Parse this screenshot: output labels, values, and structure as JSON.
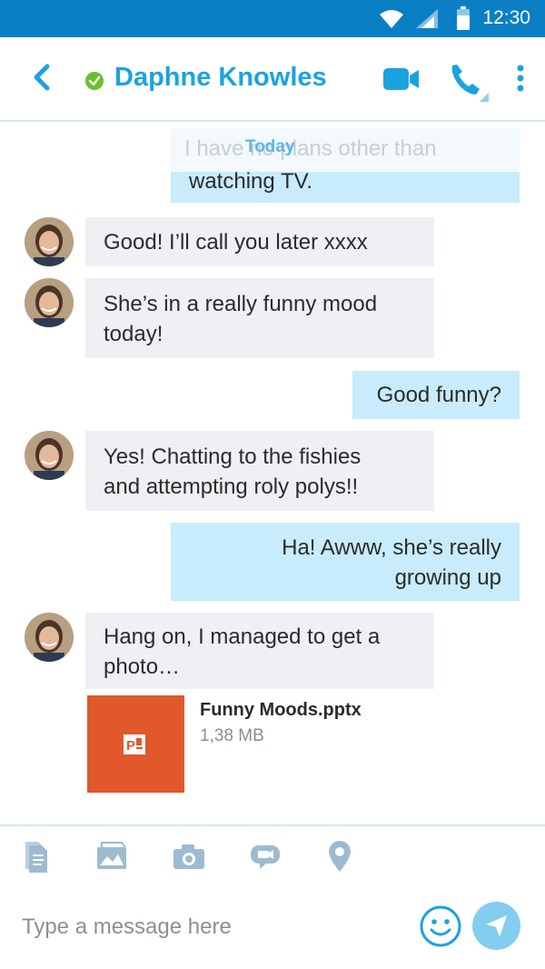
{
  "status_bar": {
    "time": "12:30"
  },
  "header": {
    "contact_name": "Daphne Knowles",
    "presence": "online",
    "accent_color": "#1aa3e1",
    "presence_color": "#6cbf2b",
    "icons": [
      "back-arrow-icon",
      "video-camera-icon",
      "phone-icon",
      "more-vertical-icon"
    ]
  },
  "chat": {
    "day_label": "Today",
    "faded_preview": "I have no plans other than",
    "messages": [
      {
        "direction": "out",
        "lines": [
          "watching TV."
        ]
      },
      {
        "direction": "in",
        "lines": [
          "Good! I’ll call you later xxxx"
        ]
      },
      {
        "direction": "in",
        "lines": [
          "She’s in a really funny mood",
          "today!"
        ]
      },
      {
        "direction": "out",
        "lines": [
          "Good funny?"
        ]
      },
      {
        "direction": "in",
        "lines": [
          "Yes! Chatting to the fishies",
          "and attempting roly polys!!"
        ]
      },
      {
        "direction": "out",
        "lines": [
          "Ha! Awww, she’s really",
          "growing up"
        ]
      },
      {
        "direction": "in",
        "lines": [
          "Hang on, I managed to get a",
          "photo…"
        ]
      }
    ],
    "attachment": {
      "file_name": "Funny Moods.pptx",
      "file_size": "1,38 MB",
      "icon": "powerpoint-icon",
      "color": "#e0582b"
    }
  },
  "compose": {
    "tools": [
      "document-icon",
      "image-gallery-icon",
      "camera-icon",
      "video-message-icon",
      "location-pin-icon"
    ],
    "placeholder": "Type a message here",
    "emoji_icon": "emoji-smiley-icon",
    "send_icon": "send-arrow-icon"
  }
}
